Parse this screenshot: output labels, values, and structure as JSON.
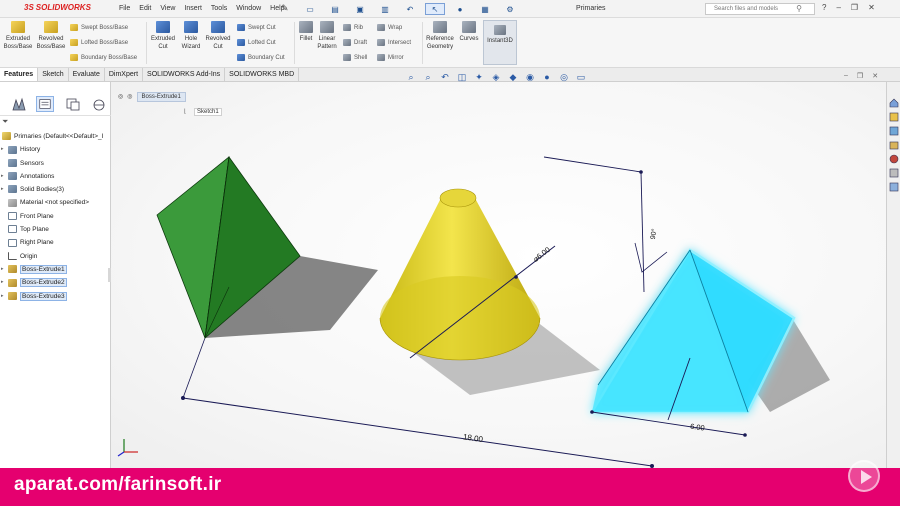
{
  "app": {
    "logo_text": "SOLIDWORKS",
    "logo_prefix": "3S",
    "document_title": "Primaries",
    "search_placeholder": "Search files and models"
  },
  "menus": [
    "File",
    "Edit",
    "View",
    "Insert",
    "Tools",
    "Window",
    "Help"
  ],
  "ribbon": {
    "extruded_boss": "Extruded Boss/Base",
    "revolved_boss": "Revolved Boss/Base",
    "swept_boss": "Swept Boss/Base",
    "lofted_boss": "Lofted Boss/Base",
    "boundary_boss": "Boundary Boss/Base",
    "extruded_cut": "Extruded Cut",
    "hole_wizard": "Hole Wizard",
    "revolved_cut": "Revolved Cut",
    "swept_cut": "Swept Cut",
    "lofted_cut": "Lofted Cut",
    "boundary_cut": "Boundary Cut",
    "fillet": "Fillet",
    "linear_pattern": "Linear Pattern",
    "rib": "Rib",
    "draft": "Draft",
    "shell": "Shell",
    "wrap": "Wrap",
    "intersect": "Intersect",
    "mirror": "Mirror",
    "reference_geometry": "Reference Geometry",
    "curves": "Curves",
    "instant3d": "Instant3D"
  },
  "tabs": [
    "Features",
    "Sketch",
    "Evaluate",
    "DimXpert",
    "SOLIDWORKS Add-Ins",
    "SOLIDWORKS MBD"
  ],
  "tree": {
    "root": "Primaries  (Default<<Default>_I",
    "items": [
      {
        "label": "History",
        "icon": "folder-icon"
      },
      {
        "label": "Sensors",
        "icon": "sensor-icon"
      },
      {
        "label": "Annotations",
        "icon": "annotation-icon"
      },
      {
        "label": "Solid Bodies(3)",
        "icon": "solid-bodies-icon"
      },
      {
        "label": "Material <not specified>",
        "icon": "material-icon"
      },
      {
        "label": "Front Plane",
        "icon": "plane-icon"
      },
      {
        "label": "Top Plane",
        "icon": "plane-icon"
      },
      {
        "label": "Right Plane",
        "icon": "plane-icon"
      },
      {
        "label": "Origin",
        "icon": "origin-icon"
      },
      {
        "label": "Boss-Extrude1",
        "icon": "feature-icon"
      },
      {
        "label": "Boss-Extrude2",
        "icon": "feature-icon"
      },
      {
        "label": "Boss-Extrude3",
        "icon": "feature-icon"
      }
    ]
  },
  "breadcrumb": {
    "feature": "Boss-Extrude1",
    "sketch": "Sketch1"
  },
  "dimensions": {
    "base_distance": "18.00",
    "cone_diameter": "⌀6.00",
    "cube_edge": "6.00",
    "angle": "90°"
  },
  "scene": {
    "pyramid_color": "#2f8a2f",
    "cone_color": "#d8c81c",
    "cube_color": "#1fd6ff",
    "dimension_color": "#1a1a55"
  },
  "watermark": "aparat.com/farinsoft.ir"
}
